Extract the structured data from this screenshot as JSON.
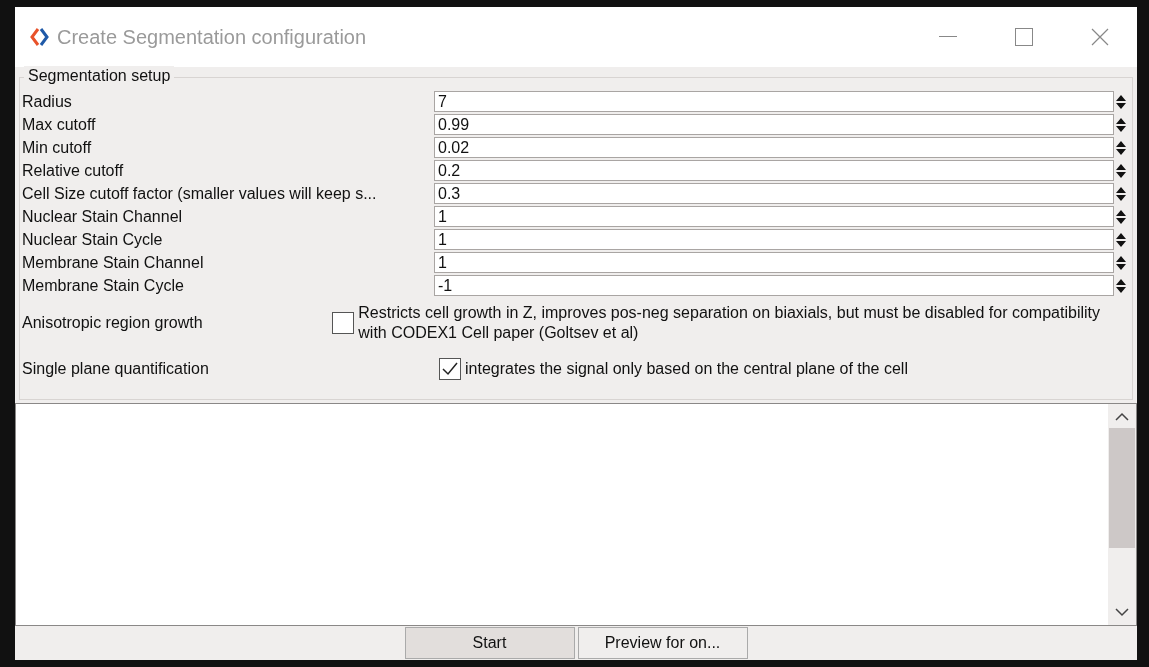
{
  "window": {
    "title": "Create Segmentation configuration"
  },
  "group": {
    "title": "Segmentation setup",
    "fields": [
      {
        "label": "Radius",
        "value": "7"
      },
      {
        "label": "Max cutoff",
        "value": "0.99"
      },
      {
        "label": "Min cutoff",
        "value": "0.02"
      },
      {
        "label": "Relative cutoff",
        "value": "0.2"
      },
      {
        "label": "Cell Size cutoff factor (smaller values will keep s...",
        "value": "0.3"
      },
      {
        "label": "Nuclear Stain Channel",
        "value": "1"
      },
      {
        "label": "Nuclear Stain Cycle",
        "value": "1"
      },
      {
        "label": "Membrane Stain Channel",
        "value": "1"
      },
      {
        "label": "Membrane Stain Cycle",
        "value": "-1"
      }
    ],
    "options": [
      {
        "label": "Anisotropic region growth",
        "description": "Restricts cell growth in Z, improves pos-neg separation on biaxials, but must be disabled for compatibility with CODEX1 Cell paper (Goltsev et al)",
        "checked": false
      },
      {
        "label": "Single plane quantification",
        "description": "integrates the signal only based on the central plane of the cell",
        "checked": true
      }
    ]
  },
  "buttons": [
    "Start",
    "Preview for on..."
  ]
}
